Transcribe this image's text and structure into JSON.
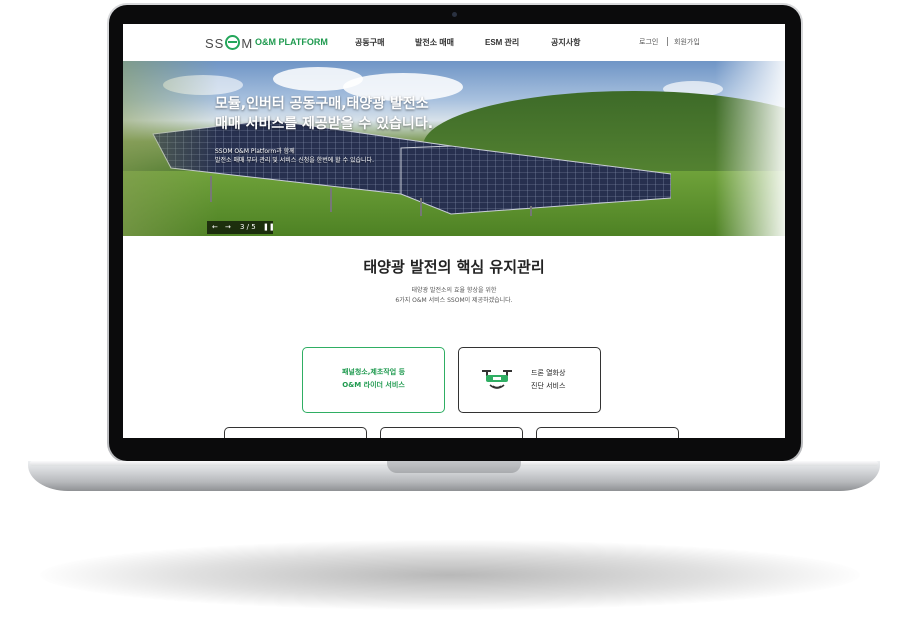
{
  "brand": {
    "logo_text_left": "SS",
    "logo_text_right": "M",
    "platform_name": "O&M PLATFORM",
    "accent_color": "#1f9a4f"
  },
  "nav": {
    "items": [
      "공동구매",
      "발전소 매매",
      "ESM 관리",
      "공지사항"
    ],
    "login": "로그인",
    "signup": "회원가입"
  },
  "hero": {
    "title_line1": "모듈,인버터 공동구매,태양광 발전소",
    "title_line2": "매매 서비스를 제공받을 수 있습니다.",
    "sub_line1": "SSOM O&M Platform과 함께",
    "sub_line2": "발전소 매매 부터 관리 및 서비스 신청을 한번에 할 수 있습니다.",
    "slide_indicator": "3 / 5",
    "prev_icon": "arrow-left-icon",
    "next_icon": "arrow-right-icon",
    "pause_icon": "pause-icon"
  },
  "section": {
    "title": "태양광 발전의 핵심 유지관리",
    "desc_line1": "태양광 발전소의 효율 향상을 위한",
    "desc_line2": "6가지 O&M 서비스 SSOM이 제공하겠습니다."
  },
  "cards": [
    {
      "line1": "패널청소,제초작업 등",
      "line2": "O&M 라이더 서비스"
    },
    {
      "line1": "드론 열화상",
      "line2": "진단 서비스",
      "icon": "drone-icon"
    }
  ]
}
